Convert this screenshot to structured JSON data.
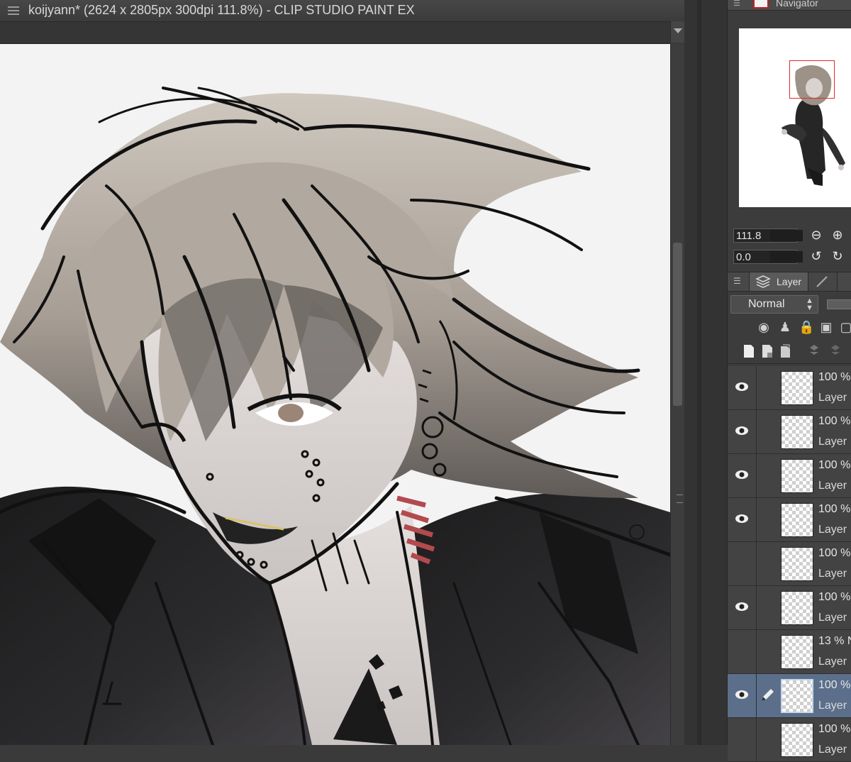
{
  "window": {
    "title": "koijyann* (2624 x 2805px 300dpi 111.8%)  - CLIP STUDIO PAINT EX"
  },
  "navigator": {
    "title": "Navigator",
    "zoom_value": "111.8",
    "rotate_value": "0.0",
    "icons": [
      "zoom-out-icon",
      "zoom-in-icon",
      "rotate-left-icon",
      "rotate-right-icon"
    ]
  },
  "layer_panel": {
    "tab_label": "Layer",
    "blend_mode": "Normal",
    "layers": [
      {
        "opacity": "100 %",
        "name": "Layer",
        "visible": true,
        "selected": false
      },
      {
        "opacity": "100 %",
        "name": "Layer",
        "visible": true,
        "selected": false
      },
      {
        "opacity": "100 %",
        "name": "Layer",
        "visible": true,
        "selected": false
      },
      {
        "opacity": "100 %",
        "name": "Layer",
        "visible": true,
        "selected": false
      },
      {
        "opacity": "100 %",
        "name": "Layer",
        "visible": false,
        "selected": false
      },
      {
        "opacity": "100 %",
        "name": "Layer",
        "visible": true,
        "selected": false
      },
      {
        "opacity": "13 % N",
        "name": "Layer",
        "visible": false,
        "selected": false
      },
      {
        "opacity": "100 %",
        "name": "Layer",
        "visible": true,
        "selected": true
      },
      {
        "opacity": "100 %",
        "name": "Layer",
        "visible": false,
        "selected": false
      }
    ]
  },
  "colors": {
    "accent_red": "#e12b2b",
    "selection_blue": "#5b6f8b",
    "panel_bg": "#3c3c3c"
  }
}
